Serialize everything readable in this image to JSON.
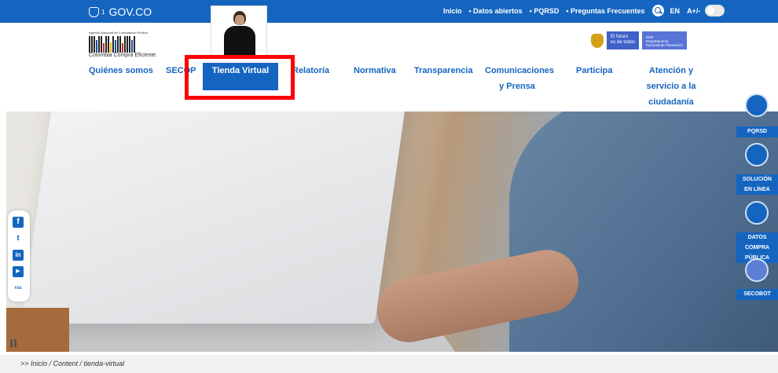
{
  "gov": {
    "logo_text": "GOV.CO",
    "logo_sup": "1"
  },
  "topnav": {
    "items": [
      "Inicio",
      "• Datos abiertos",
      "• PQRSD",
      "• Preguntas Frecuentes"
    ],
    "lang": "EN",
    "font_size": "A+/-",
    "search_icon": "search-icon",
    "contrast_toggle": "toggle"
  },
  "logo": {
    "small": "Agencia Nacional de Contratación Pública",
    "name": "Colombia Compra Eficiente"
  },
  "futuro": {
    "line1": "El futuro",
    "line2": "es de todos",
    "dnp1": "DNP",
    "dnp2": "Departamento",
    "dnp3": "Nacional de Planeación"
  },
  "mainnav": {
    "quienes": "Quiénes somos",
    "secop": "SECOP",
    "tienda": "Tienda Virtual",
    "relatoria": "Relatoría",
    "normativa": "Normativa",
    "transparencia": "Transparencia",
    "comunicaciones1": "Comunicaciones",
    "comunicaciones2": "y Prensa",
    "participa": "Participa",
    "atencion1": "Atención y",
    "atencion2": "servicio a la",
    "atencion3": "ciudadanía"
  },
  "side": {
    "pqrsd": "PQRSD",
    "solucion1": "SOLUCIÓN",
    "solucion2": "EN LÍNEA",
    "datos1": "DATOS COMPRA",
    "datos2": "PÚBLICA",
    "secobot": "SECOBOT"
  },
  "social": [
    "f",
    "t",
    "in",
    "▶",
    "rss"
  ],
  "breadcrumb": ">> Inicio / Content / tienda-virtual",
  "colors": {
    "primary": "#1565c0",
    "highlight": "#ff0000"
  }
}
